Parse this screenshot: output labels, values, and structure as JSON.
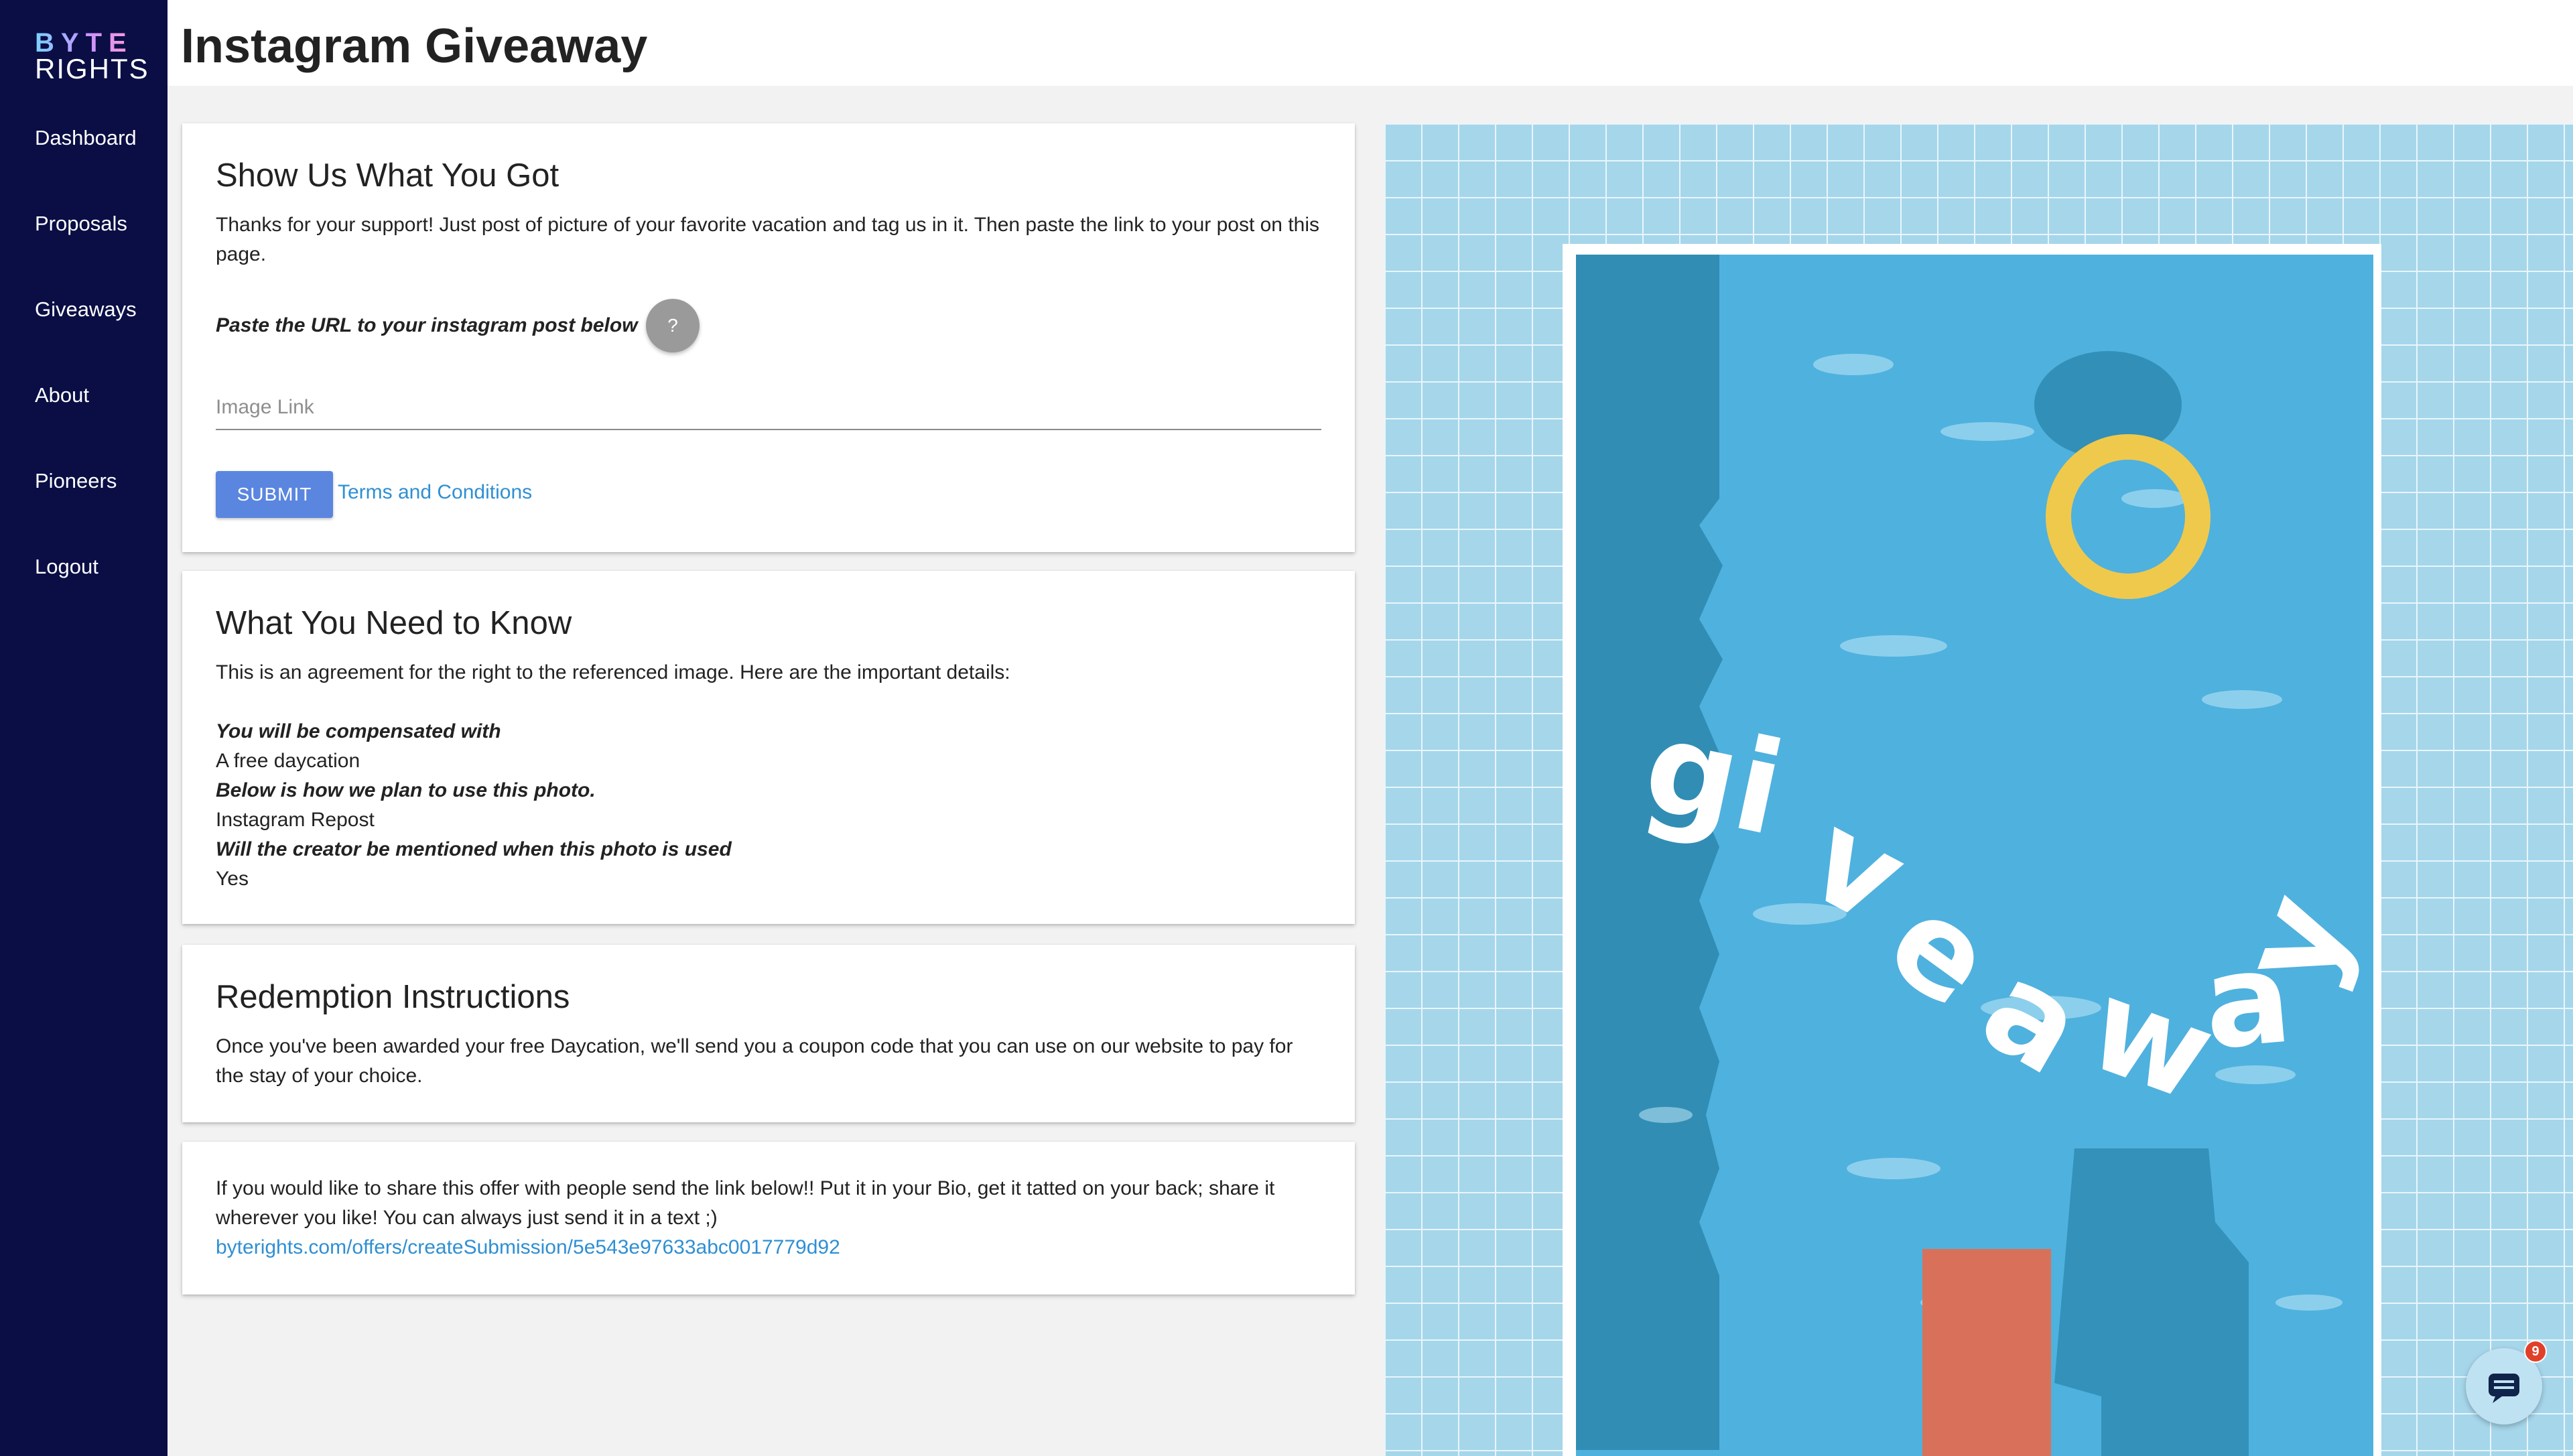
{
  "brand": {
    "logo_top": "BYTE",
    "logo_bottom": "RIGHTS"
  },
  "sidebar": {
    "items": [
      {
        "label": "Dashboard"
      },
      {
        "label": "Proposals"
      },
      {
        "label": "Giveaways"
      },
      {
        "label": "About"
      },
      {
        "label": "Pioneers"
      },
      {
        "label": "Logout"
      }
    ]
  },
  "header": {
    "title": "Instagram Giveaway"
  },
  "submit_card": {
    "title": "Show Us What You Got",
    "intro": "Thanks for your support! Just post of picture of your favorite vacation and tag us in it. Then paste the link to your post on this page.",
    "url_prompt": "Paste the URL to your instagram post below",
    "help_label": "?",
    "input_placeholder": "Image Link",
    "input_value": "",
    "submit_label": "SUBMIT",
    "terms_label": "Terms and Conditions"
  },
  "details_card": {
    "title": "What You Need to Know",
    "intro": "This is an agreement for the right to the referenced image. Here are the important details:",
    "compensation_label": "You will be compensated with",
    "compensation_value": "A free daycation",
    "usage_label": "Below is how we plan to use this photo.",
    "usage_value": "Instagram Repost",
    "credit_label": "Will the creator be mentioned when this photo is used",
    "credit_value": "Yes"
  },
  "redemption_card": {
    "title": "Redemption Instructions",
    "text": "Once you've been awarded your free Daycation, we'll send you a coupon code that you can use on our website to pay for the stay of your choice."
  },
  "share_card": {
    "text": "If you would like to share this offer with people send the link below!! Put it in your Bio, get it tatted on your back; share it wherever you like! You can always just send it in a text ;)",
    "link": "byterights.com/offers/createSubmission/5e543e97633abc0017779d92"
  },
  "promo_image": {
    "word": "giveaway"
  },
  "chat": {
    "badge_count": "9"
  },
  "colors": {
    "sidebar_bg": "#0a0e45",
    "accent_button": "#5a86e0",
    "link": "#2f8fd3",
    "pool_water": "#4fb1de",
    "float_ring": "#efc94c",
    "ladder": "#d9715a"
  }
}
